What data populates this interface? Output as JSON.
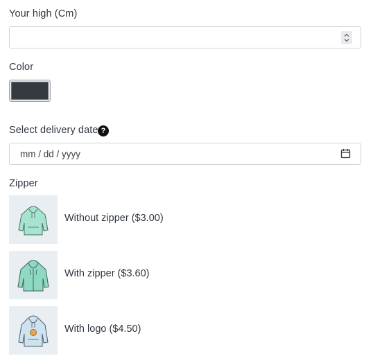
{
  "height_field": {
    "label": "Your high (Cm)",
    "value": ""
  },
  "color_field": {
    "label": "Color",
    "value": "#343a40"
  },
  "delivery_field": {
    "label": "Select delivery date",
    "help_icon": "?",
    "placeholder": "mm / dd / yyyy"
  },
  "zipper": {
    "label": "Zipper",
    "options": [
      {
        "label": "Without zipper ($3.00)",
        "icon": "hoodie-no-zipper-image"
      },
      {
        "label": "With zipper ($3.60)",
        "icon": "hoodie-zipper-image"
      },
      {
        "label": "With logo ($4.50)",
        "icon": "hoodie-logo-image"
      }
    ]
  },
  "colors": {
    "hoodie_green": "#8fd8c2",
    "hoodie_blue": "#b9d6ea",
    "logo_orange": "#f0a24a"
  }
}
